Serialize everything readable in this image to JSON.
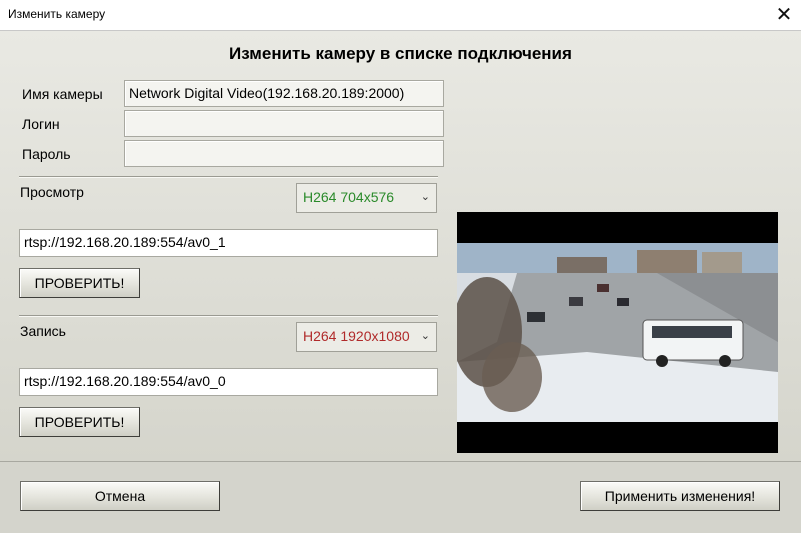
{
  "window": {
    "title": "Изменить камеру"
  },
  "dialog": {
    "heading": "Изменить камеру в списке подключения",
    "camera_name_label": "Имя камеры",
    "camera_name_value": "Network Digital Video(192.168.20.189:2000)",
    "login_label": "Логин",
    "login_value": "",
    "password_label": "Пароль",
    "password_value": "",
    "view": {
      "label": "Просмотр",
      "stream_selected": "H264 704x576",
      "stream_color": "#2a8a2a",
      "url": "rtsp://192.168.20.189:554/av0_1",
      "check_button": "ПРОВЕРИТЬ!"
    },
    "record": {
      "label": "Запись",
      "stream_selected": "H264 1920x1080",
      "stream_color": "#b02a2a",
      "url": "rtsp://192.168.20.189:554/av0_0",
      "check_button": "ПРОВЕРИТЬ!"
    }
  },
  "footer": {
    "cancel_button": "Отмена",
    "apply_button": "Применить изменения!"
  }
}
